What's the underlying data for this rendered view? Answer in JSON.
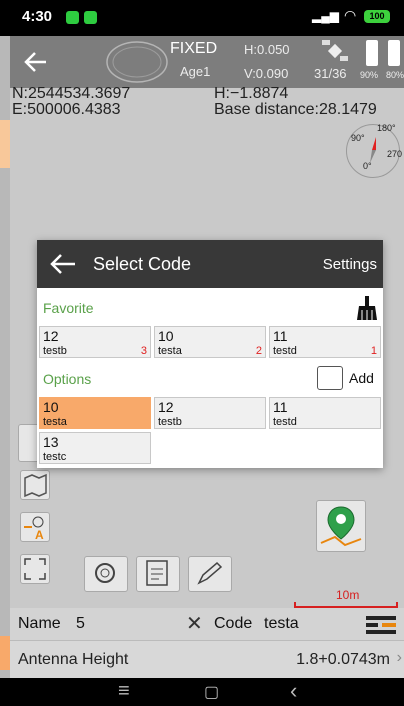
{
  "status_bar": {
    "time": "4:30",
    "battery": "100"
  },
  "top_bar": {
    "fix_status": "FIXED",
    "age": "Age1",
    "h_precision": "H:0.050",
    "v_precision": "V:0.090",
    "satellites": "31/36",
    "battery_1": "90%",
    "battery_2": "80%"
  },
  "coords": {
    "north": "N:2544534.3697",
    "east": "E:500006.4383",
    "height": "H:−1.8874",
    "base_distance": "Base distance:28.1479"
  },
  "compass": {
    "deg_0": "0°",
    "deg_90": "90°",
    "deg_180": "180°",
    "deg_270": "270"
  },
  "dialog": {
    "title": "Select Code",
    "settings_label": "Settings",
    "favorite_label": "Favorite",
    "options_label": "Options",
    "add_label": "Add",
    "favorites": [
      {
        "code": "12",
        "name": "testb",
        "count": "3"
      },
      {
        "code": "10",
        "name": "testa",
        "count": "2"
      },
      {
        "code": "11",
        "name": "testd",
        "count": "1"
      }
    ],
    "options": [
      {
        "code": "10",
        "name": "testa"
      },
      {
        "code": "12",
        "name": "testb"
      },
      {
        "code": "11",
        "name": "testd"
      },
      {
        "code": "13",
        "name": "testc"
      }
    ]
  },
  "scale_label": "10m",
  "bottom": {
    "name_label": "Name",
    "name_value": "5",
    "code_label": "Code",
    "code_value": "testa",
    "antenna_label": "Antenna Height",
    "antenna_value": "1.8+0.0743m"
  },
  "nav": {
    "menu": "≡",
    "home": "▢",
    "back": "‹"
  },
  "colors": {
    "accent_orange": "#f8a96a",
    "green": "#5aa14a",
    "red": "#e02020"
  }
}
